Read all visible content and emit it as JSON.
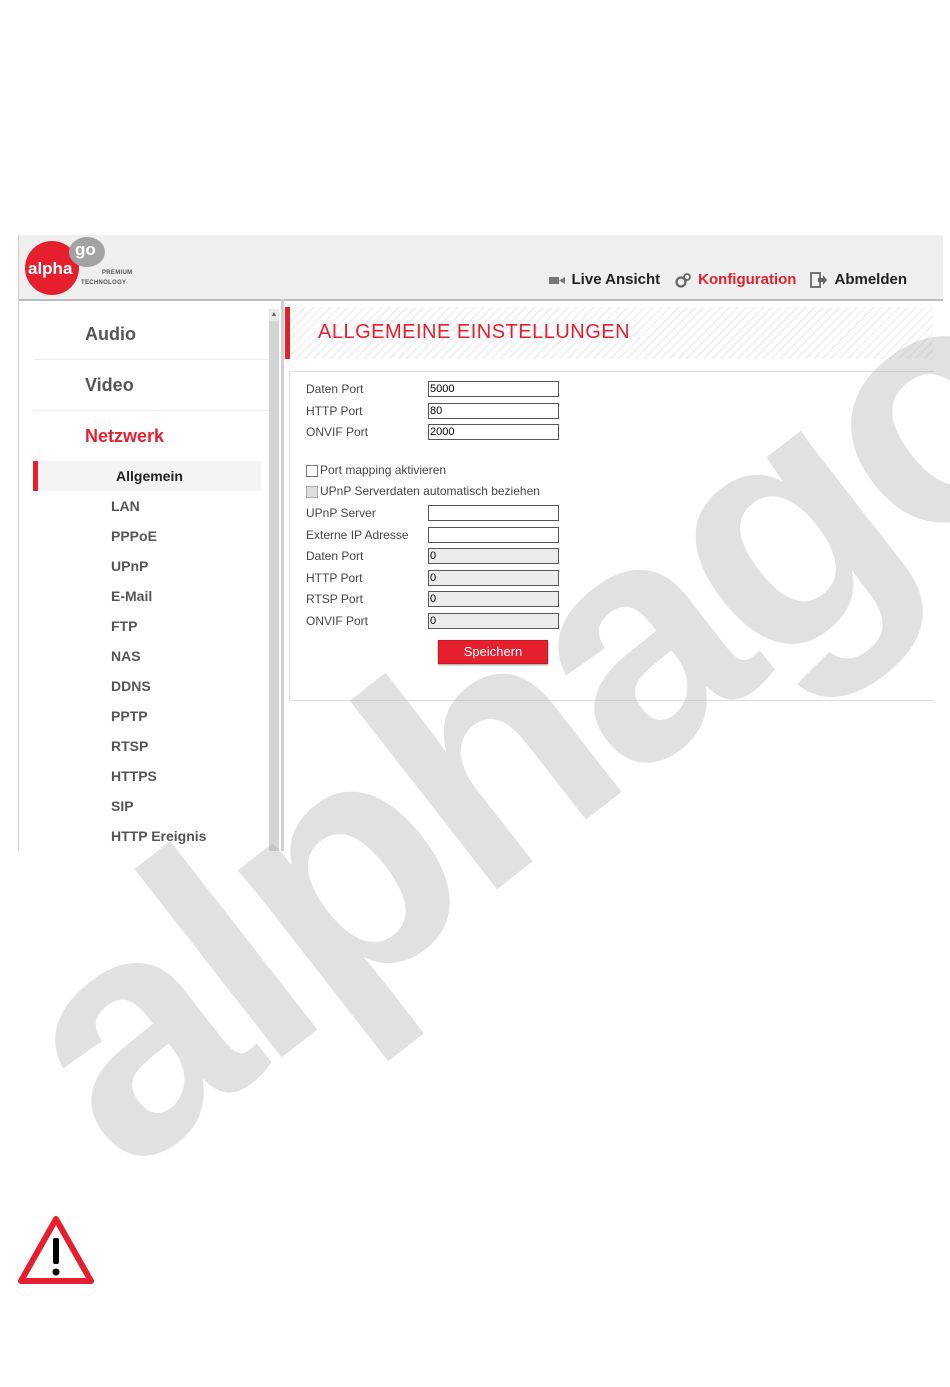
{
  "logo": {
    "alpha": "alpha",
    "go": "go",
    "premium": "PREMIUM",
    "technology": "TECHNOLOGY"
  },
  "nav": {
    "live": "Live Ansicht",
    "config": "Konfiguration",
    "logout": "Abmelden"
  },
  "sidebar": {
    "main": [
      "Audio",
      "Video",
      "Netzwerk"
    ],
    "sub": [
      "Allgemein",
      "LAN",
      "PPPoE",
      "UPnP",
      "E-Mail",
      "FTP",
      "NAS",
      "DDNS",
      "PPTP",
      "RTSP",
      "HTTPS",
      "SIP",
      "HTTP Ereignis"
    ]
  },
  "page": {
    "title": "ALLGEMEINE EINSTELLUNGEN"
  },
  "form": {
    "data_port_label": "Daten Port",
    "data_port_value": "5000",
    "http_port_label": "HTTP Port",
    "http_port_value": "80",
    "onvif_port_label": "ONVIF Port",
    "onvif_port_value": "2000",
    "port_mapping_label": "Port mapping aktivieren",
    "upnp_auto_label": "UPnP Serverdaten automatisch beziehen",
    "upnp_server_label": "UPnP Server",
    "upnp_server_value": "",
    "external_ip_label": "Externe IP Adresse",
    "external_ip_value": "",
    "ext_data_port_label": "Daten Port",
    "ext_data_port_value": "0",
    "ext_http_port_label": "HTTP Port",
    "ext_http_port_value": "0",
    "ext_rtsp_port_label": "RTSP Port",
    "ext_rtsp_port_value": "0",
    "ext_onvif_port_label": "ONVIF Port",
    "ext_onvif_port_value": "0",
    "save_label": "Speichern"
  },
  "watermark": "alphago",
  "colors": {
    "accent": "#e51f2e"
  }
}
